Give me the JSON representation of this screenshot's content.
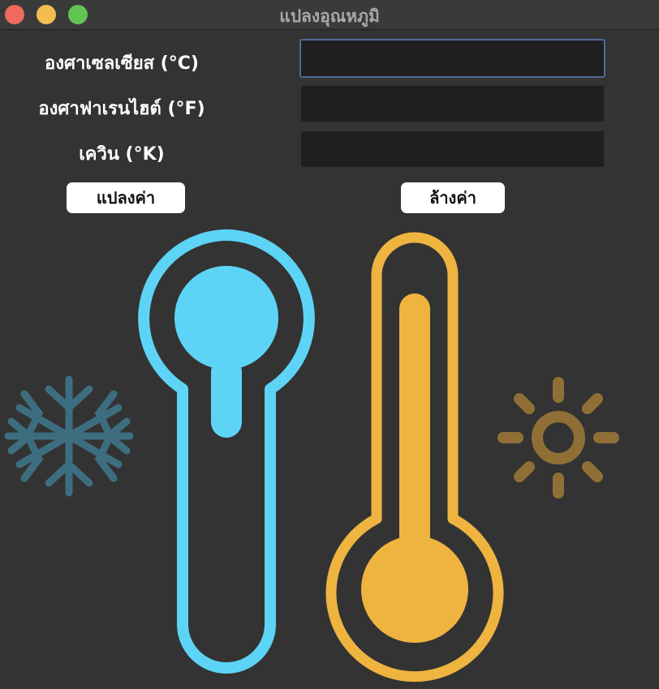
{
  "window": {
    "title": "แปลงอุณหภูมิ"
  },
  "form": {
    "celsius_label": "องศาเซลเซียส (°C)",
    "fahrenheit_label": "องศาฟาเรนไฮต์ (°F)",
    "kelvin_label": "เควิน (°K)",
    "celsius_value": "",
    "fahrenheit_value": "",
    "kelvin_value": ""
  },
  "buttons": {
    "convert_label": "แปลงค่า",
    "clear_label": "ล้างค่า"
  },
  "icons": {
    "cold": "snowflake-icon",
    "cold_thermometer": "cold-thermometer-icon",
    "hot_thermometer": "hot-thermometer-icon",
    "hot": "sun-icon"
  },
  "colors": {
    "cold": "#5dd4f6",
    "cold_dim": "#3d6e80",
    "hot": "#efb440",
    "hot_dim": "#8f6f35",
    "background": "#333333"
  }
}
